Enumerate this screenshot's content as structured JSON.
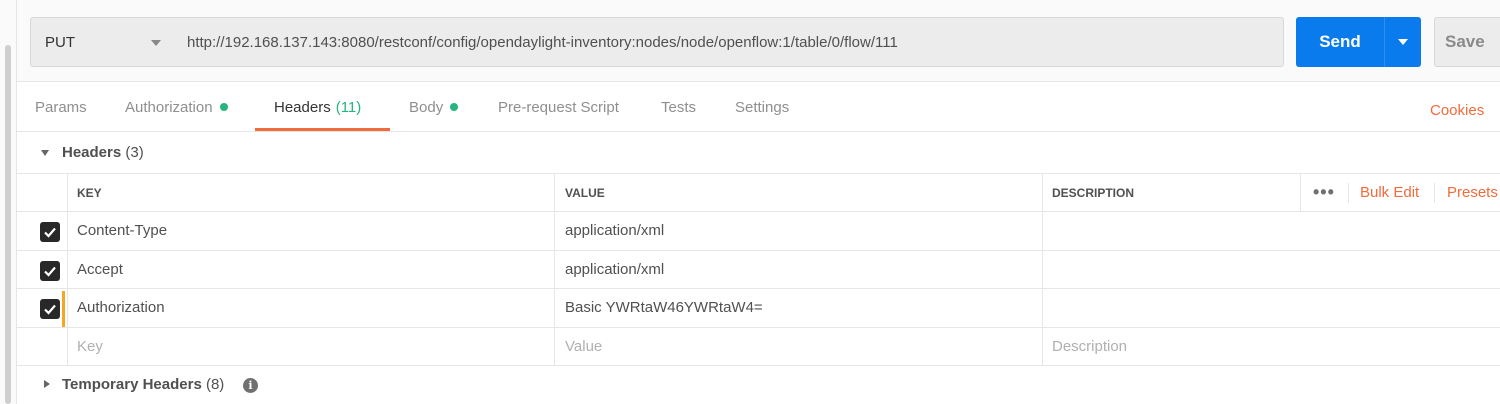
{
  "request": {
    "method": "PUT",
    "url": "http://192.168.137.143:8080/restconf/config/opendaylight-inventory:nodes/node/openflow:1/table/0/flow/111",
    "send_label": "Send",
    "save_label": "Save"
  },
  "tabs": [
    {
      "label": "Params",
      "dot": false
    },
    {
      "label": "Authorization",
      "dot": true
    },
    {
      "label": "Headers",
      "count": "(11)",
      "active": true
    },
    {
      "label": "Body",
      "dot": true
    },
    {
      "label": "Pre-request Script",
      "dot": false
    },
    {
      "label": "Tests",
      "dot": false
    },
    {
      "label": "Settings",
      "dot": false
    }
  ],
  "cookies_label": "Cookies",
  "headers_section": {
    "title": "Headers",
    "count": "(3)"
  },
  "table": {
    "columns": {
      "key": "KEY",
      "value": "VALUE",
      "description": "DESCRIPTION"
    },
    "bulk_edit_label": "Bulk Edit",
    "presets_label": "Presets",
    "more_label": "•••",
    "rows": [
      {
        "checked": true,
        "key": "Content-Type",
        "value": "application/xml",
        "description": ""
      },
      {
        "checked": true,
        "key": "Accept",
        "value": "application/xml",
        "description": ""
      },
      {
        "checked": true,
        "key": "Authorization",
        "value": "Basic YWRtaW46YWRtaW4=",
        "description": ""
      }
    ],
    "placeholder": {
      "key": "Key",
      "value": "Value",
      "description": "Description"
    }
  },
  "temporary_section": {
    "title": "Temporary Headers",
    "count": "(8)"
  },
  "colors": {
    "accent": "#f26b3a",
    "send": "#097bed",
    "dot": "#26b47f",
    "marker": "#f5a623"
  }
}
